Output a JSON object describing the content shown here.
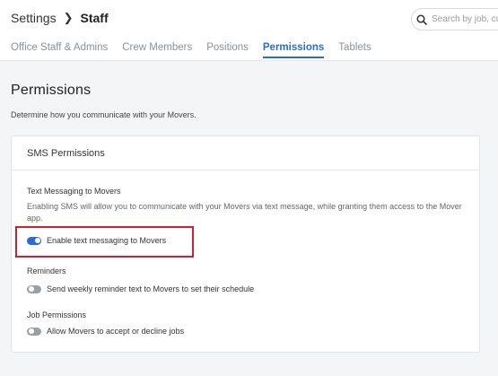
{
  "header": {
    "breadcrumb_root": "Settings",
    "breadcrumb_current": "Staff",
    "search_placeholder": "Search by job, cu"
  },
  "tabs": [
    {
      "label": "Office Staff & Admins",
      "active": false
    },
    {
      "label": "Crew Members",
      "active": false
    },
    {
      "label": "Positions",
      "active": false
    },
    {
      "label": "Permissions",
      "active": true
    },
    {
      "label": "Tablets",
      "active": false
    }
  ],
  "page": {
    "title": "Permissions",
    "description": "Determine how you communicate with your Movers."
  },
  "sms_card": {
    "header": "SMS Permissions",
    "text_messaging": {
      "title": "Text Messaging to Movers",
      "description": "Enabling SMS will allow you to communicate with your Movers via text message, while granting them access to the Mover app.",
      "toggle_label": "Enable text messaging to Movers",
      "enabled": true
    },
    "reminders": {
      "title": "Reminders",
      "toggle_label": "Send weekly reminder text to Movers to set their schedule",
      "enabled": false
    },
    "job_permissions": {
      "title": "Job Permissions",
      "toggle_label": "Allow Movers to accept or decline jobs",
      "enabled": false
    }
  },
  "colors": {
    "accent": "#2a6bd6",
    "highlight": "#d0202f"
  }
}
